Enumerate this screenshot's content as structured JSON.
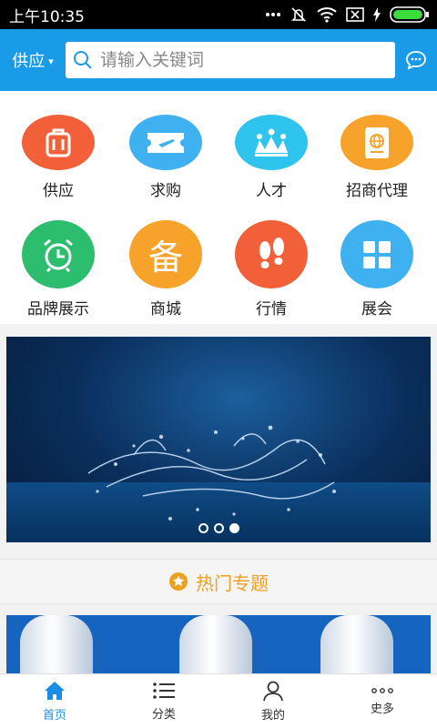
{
  "status_bar": {
    "time": "上午10:35"
  },
  "header": {
    "category": "供应",
    "search_placeholder": "请输入关键词"
  },
  "grid": [
    {
      "label": "供应",
      "icon": "suitcase-icon",
      "color": "#f2603a"
    },
    {
      "label": "求购",
      "icon": "ticket-icon",
      "color": "#3fb0f0"
    },
    {
      "label": "人才",
      "icon": "crown-icon",
      "color": "#2ec4ee"
    },
    {
      "label": "招商代理",
      "icon": "passport-icon",
      "color": "#f7a22a"
    },
    {
      "label": "品牌展示",
      "icon": "alarm-clock-icon",
      "color": "#2dbd6e"
    },
    {
      "label": "商城",
      "icon": "bei-character-icon",
      "glyph": "备",
      "color": "#f7a22a"
    },
    {
      "label": "行情",
      "icon": "footprints-icon",
      "color": "#f2603a"
    },
    {
      "label": "展会",
      "icon": "grid-icon",
      "color": "#3fb0f0"
    }
  ],
  "banner": {
    "slides": 3,
    "active": 3
  },
  "section": {
    "title": "热门专题",
    "icon": "star-icon",
    "color": "#f0a020"
  },
  "tabbar": [
    {
      "label": "首页",
      "icon": "home-icon",
      "active": true
    },
    {
      "label": "分类",
      "icon": "list-icon",
      "active": false
    },
    {
      "label": "我的",
      "icon": "user-icon",
      "active": false
    },
    {
      "label": "史多",
      "icon": "more-dots-icon",
      "active": false
    }
  ]
}
